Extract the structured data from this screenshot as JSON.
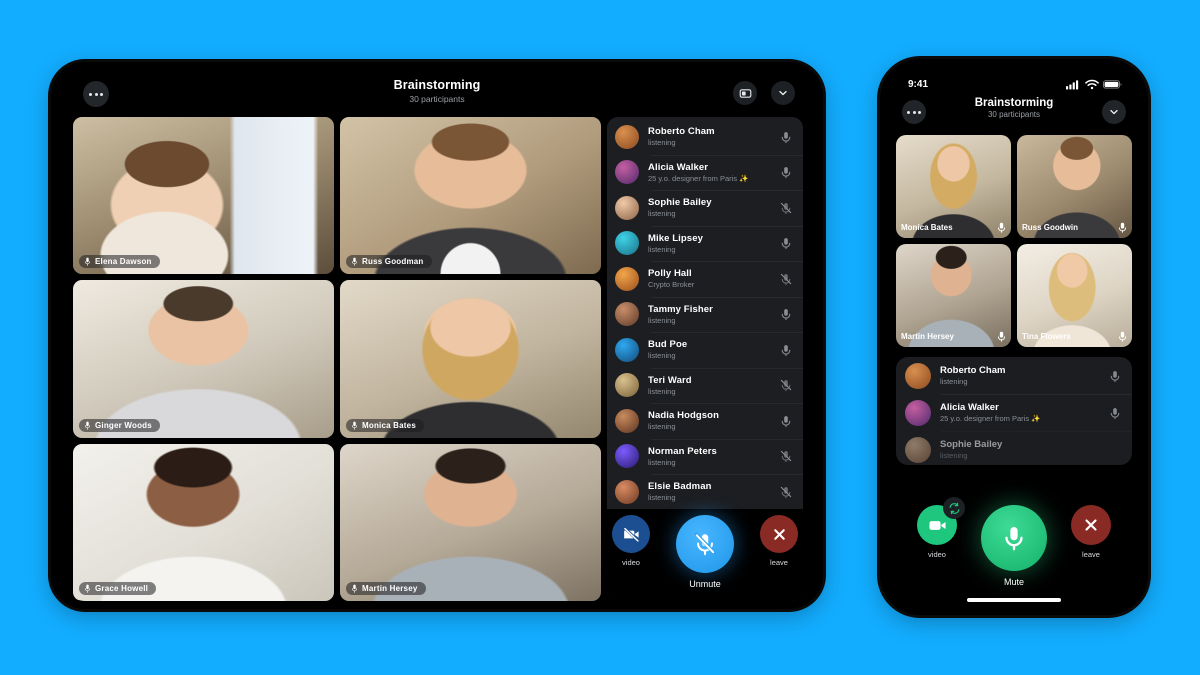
{
  "background_color": "#13ADFF",
  "tablet": {
    "header": {
      "menu_button": "•••",
      "title": "Brainstorming",
      "subtitle": "30 participants",
      "pip_icon": "screen-layout-icon",
      "collapse_icon": "chevron-down-icon"
    },
    "video_tiles": [
      {
        "name": "Elena Dawson",
        "mic": "on",
        "bg1": "#b9a98e",
        "bg2": "#6d5c46",
        "skin": "#e8c6a8",
        "hair": "#6b4a2f",
        "top": "#efe7dc"
      },
      {
        "name": "Russ Goodman",
        "mic": "on",
        "bg1": "#c8b79d",
        "bg2": "#8d7a60",
        "skin": "#e7bd99",
        "hair": "#7a5536",
        "top": "#3a3a3c"
      },
      {
        "name": "Ginger Woods",
        "mic": "on",
        "bg1": "#e3ded3",
        "bg2": "#b3ab9b",
        "skin": "#e9c3a3",
        "hair": "#4a3a2c",
        "top": "#d9d9db"
      },
      {
        "name": "Monica Bates",
        "mic": "on",
        "bg1": "#ded4c4",
        "bg2": "#a99b86",
        "skin": "#eec7a6",
        "hair": "#c8a25e",
        "top": "#2e2e30"
      },
      {
        "name": "Grace Howell",
        "mic": "on",
        "bg1": "#e9e7e2",
        "bg2": "#c4c1b8",
        "skin": "#8c5f45",
        "hair": "#2b1d16",
        "top": "#f2f1ee"
      },
      {
        "name": "Martin Hersey",
        "mic": "on",
        "bg1": "#d7cfc4",
        "bg2": "#9c907f",
        "skin": "#dfb292",
        "hair": "#2b211a",
        "top": "#a9b1b8"
      }
    ],
    "participants": [
      {
        "name": "Roberto Cham",
        "status": "listening",
        "mic": "on",
        "av1": "#d98f4f",
        "av2": "#8c4a1f"
      },
      {
        "name": "Alicia Walker",
        "status": "25 y.o. designer from Paris ✨",
        "mic": "on",
        "av1": "#c45fa0",
        "av2": "#4f2a6d"
      },
      {
        "name": "Sophie Bailey",
        "status": "listening",
        "mic": "muted",
        "av1": "#f0c9a8",
        "av2": "#8b6246"
      },
      {
        "name": "Mike Lipsey",
        "status": "listening",
        "mic": "on",
        "av1": "#3fd3e8",
        "av2": "#1a6f86"
      },
      {
        "name": "Polly Hall",
        "status": "Crypto Broker",
        "mic": "muted",
        "av1": "#f2a64a",
        "av2": "#9a4e1c"
      },
      {
        "name": "Tammy Fisher",
        "status": "listening",
        "mic": "on",
        "av1": "#c98e6a",
        "av2": "#5e3a28"
      },
      {
        "name": "Bud Poe",
        "status": "listening",
        "mic": "on",
        "av1": "#2fa8ef",
        "av2": "#124b7a"
      },
      {
        "name": "Teri Ward",
        "status": "listening",
        "mic": "muted",
        "av1": "#d8c08e",
        "av2": "#7a6238"
      },
      {
        "name": "Nadia Hodgson",
        "status": "listening",
        "mic": "on",
        "av1": "#c88b5e",
        "av2": "#5c3420"
      },
      {
        "name": "Norman Peters",
        "status": "listening",
        "mic": "muted",
        "av1": "#7c5cff",
        "av2": "#2a1a6e"
      },
      {
        "name": "Elsie Badman",
        "status": "listening",
        "mic": "muted",
        "av1": "#d98b63",
        "av2": "#6d3a22"
      }
    ],
    "controls": {
      "video_label": "video",
      "video_state": "off",
      "video_color": "#1c4f91",
      "mic_label": "Unmute",
      "mic_state": "muted",
      "mic_color": "#2CA6F5",
      "leave_label": "leave",
      "leave_color": "#8a2a24"
    }
  },
  "phone": {
    "status_bar": {
      "time": "9:41",
      "signal_icon": "cellular-signal-icon",
      "wifi_icon": "wifi-icon",
      "battery_icon": "battery-icon"
    },
    "header": {
      "menu_button": "•••",
      "title": "Brainstorming",
      "subtitle": "30 participants",
      "collapse_icon": "chevron-down-icon"
    },
    "video_tiles": [
      {
        "name": "Monica Bates",
        "mic": "on",
        "bg1": "#ded4c4",
        "bg2": "#a99b86",
        "skin": "#eec7a6",
        "hair": "#c8a25e",
        "top": "#2e2e30"
      },
      {
        "name": "Russ Goodwin",
        "mic": "on",
        "bg1": "#c8b79d",
        "bg2": "#7e6c52",
        "skin": "#e7bd99",
        "hair": "#7a5536",
        "top": "#3a3a3c"
      },
      {
        "name": "Martin Hersey",
        "mic": "on",
        "bg1": "#d7cfc4",
        "bg2": "#9c907f",
        "skin": "#dfb292",
        "hair": "#2b211a",
        "top": "#a9b1b8"
      },
      {
        "name": "Tina Flowers",
        "mic": "on",
        "bg1": "#efe9df",
        "bg2": "#c9bfae",
        "skin": "#f0c9a6",
        "hair": "#d8b878",
        "top": "#efe6d8"
      }
    ],
    "participants": [
      {
        "name": "Roberto Cham",
        "status": "listening",
        "mic": "on",
        "av1": "#d98f4f",
        "av2": "#8c4a1f"
      },
      {
        "name": "Alicia Walker",
        "status": "25 y.o. designer from Paris ✨",
        "mic": "on",
        "av1": "#c45fa0",
        "av2": "#4f2a6d"
      },
      {
        "name": "Sophie Bailey",
        "status": "listening",
        "mic": "on",
        "av1": "#f0c9a8",
        "av2": "#8b6246"
      }
    ],
    "controls": {
      "flip_icon": "camera-flip-icon",
      "video_label": "video",
      "video_state": "on",
      "video_color": "#1FC77E",
      "mic_label": "Mute",
      "mic_state": "on",
      "mic_color": "#20C073",
      "leave_label": "leave",
      "leave_color": "#8a2a24"
    }
  }
}
